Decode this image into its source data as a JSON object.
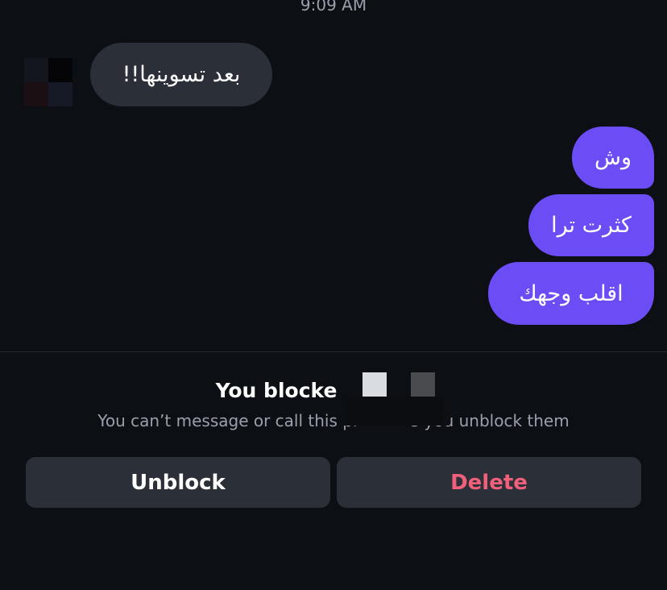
{
  "chat": {
    "timestamp": "9:09 AM",
    "messages": [
      {
        "direction": "incoming",
        "text": "بعد تسوينها!!"
      },
      {
        "direction": "outgoing",
        "text": "وش"
      },
      {
        "direction": "outgoing",
        "text": "كثرت ترا"
      },
      {
        "direction": "outgoing",
        "text": "اقلب وجهك"
      }
    ]
  },
  "blocked": {
    "title_visible": "You blocke",
    "message_visible": "You can’t message or call this pr          s you unblock them"
  },
  "actions": {
    "unblock_label": "Unblock",
    "delete_label": "Delete"
  },
  "colors": {
    "background": "#0c0f14",
    "incoming_bubble": "#2b2f37",
    "outgoing_bubble": "#6c4df5",
    "button_bg": "#2b2f37",
    "delete_text": "#f0607a",
    "muted_text": "#9aa0ab"
  }
}
